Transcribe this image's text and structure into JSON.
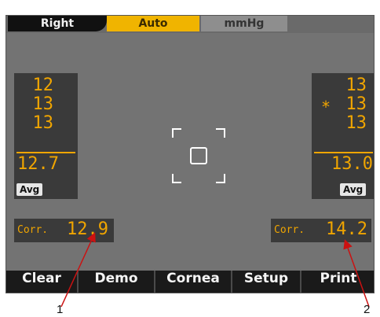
{
  "topbar": {
    "eye_label": "Right",
    "mode_label": "Auto",
    "unit_label": "mmHg"
  },
  "left_panel": {
    "readings": [
      "12",
      "13",
      "13"
    ],
    "average": "12.7",
    "avg_label": "Avg"
  },
  "right_panel": {
    "readings": [
      "13",
      "13",
      "13"
    ],
    "flag_mark": "*",
    "average": "13.0",
    "avg_label": "Avg"
  },
  "left_corr": {
    "label": "Corr.",
    "value": "12.9"
  },
  "right_corr": {
    "label": "Corr.",
    "value": "14.2"
  },
  "bottom_buttons": [
    "Clear",
    "Demo",
    "Cornea",
    "Setup",
    "Print"
  ],
  "callouts": [
    "1",
    "2"
  ],
  "colors": {
    "screen_bg": "#737373",
    "panel_bg": "#3a3a3a",
    "digit": "#f0a500",
    "auto_tab": "#f0b400",
    "arrow": "#cc1111"
  }
}
